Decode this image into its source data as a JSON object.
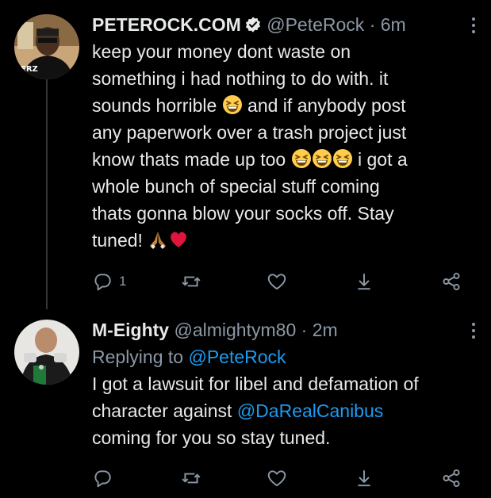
{
  "tweets": [
    {
      "author_name": "PETEROCK.COM",
      "verified": true,
      "handle": "@PeteRock",
      "separator": "·",
      "time": "6m",
      "lines": [
        "keep your money dont waste on",
        "something i had nothing to do with. it",
        "sounds horrible",
        "and if anybody post",
        "any paperwork over a trash project just",
        "know thats made up too",
        "i got a",
        "whole bunch of special stuff coming",
        "thats gonna blow your socks off. Stay",
        "tuned!"
      ],
      "reply_count": "1",
      "icons": [
        "reply-icon",
        "retweet-icon",
        "like-icon",
        "download-icon",
        "share-icon"
      ]
    },
    {
      "author_name": "M-Eighty",
      "verified": false,
      "handle": "@almightym80",
      "separator": "·",
      "time": "2m",
      "replying_prefix": "Replying to",
      "replying_to": "@PeteRock",
      "lines": [
        "I got a lawsuit for libel and defamation of",
        "character against",
        "@DaRealCanibus",
        "coming for you so stay tuned."
      ],
      "reply_count": "",
      "icons": [
        "reply-icon",
        "retweet-icon",
        "like-icon",
        "download-icon",
        "share-icon"
      ]
    }
  ],
  "colors": {
    "background": "#000000",
    "text": "#e7e9ea",
    "secondary": "#8b98a5",
    "link": "#1d9bf0",
    "verified_badge": "#e7e9ea",
    "heart_emoji": "#e0143c"
  }
}
